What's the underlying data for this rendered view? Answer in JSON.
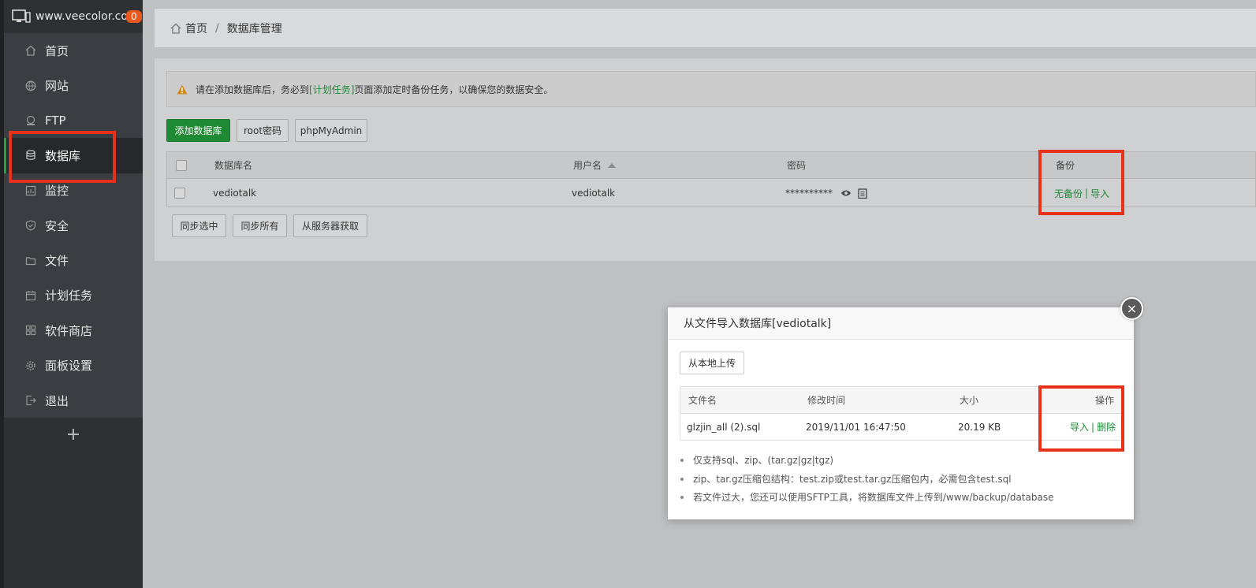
{
  "site": {
    "name": "www.veecolor.com",
    "badge": "0"
  },
  "nav": [
    {
      "label": "首页",
      "icon": "home-icon"
    },
    {
      "label": "网站",
      "icon": "globe-icon"
    },
    {
      "label": "FTP",
      "icon": "ftp-icon"
    },
    {
      "label": "数据库",
      "icon": "database-icon",
      "active": true
    },
    {
      "label": "监控",
      "icon": "monitor-chart-icon"
    },
    {
      "label": "安全",
      "icon": "shield-icon"
    },
    {
      "label": "文件",
      "icon": "folder-icon"
    },
    {
      "label": "计划任务",
      "icon": "calendar-icon"
    },
    {
      "label": "软件商店",
      "icon": "apps-grid-icon"
    },
    {
      "label": "面板设置",
      "icon": "gear-icon"
    },
    {
      "label": "退出",
      "icon": "logout-icon"
    }
  ],
  "nav_add": "+",
  "breadcrumb": {
    "home": "首页",
    "sep": "/",
    "current": "数据库管理"
  },
  "alert": {
    "before": "请在添加数据库后，务必到",
    "link": "[计划任务]",
    "after": "页面添加定时备份任务，以确保您的数据安全。"
  },
  "toolbar": {
    "add_db": "添加数据库",
    "root_pwd": "root密码",
    "phpmyadmin": "phpMyAdmin"
  },
  "table": {
    "headers": {
      "name": "数据库名",
      "user": "用户名",
      "password": "密码",
      "backup": "备份"
    },
    "rows": [
      {
        "name": "vediotalk",
        "user": "vediotalk",
        "password": "**********",
        "no_backup": "无备份",
        "sep": "|",
        "import": "导入"
      }
    ]
  },
  "bottom_buttons": {
    "sync_selected": "同步选中",
    "sync_all": "同步所有",
    "fetch_server": "从服务器获取"
  },
  "modal": {
    "title": "从文件导入数据库[vediotalk]",
    "close": "×",
    "upload": "从本地上传",
    "headers": {
      "file": "文件名",
      "mtime": "修改时间",
      "size": "大小",
      "ops": "操作"
    },
    "rows": [
      {
        "file": "glzjin_all (2).sql",
        "mtime": "2019/11/01 16:47:50",
        "size": "20.19 KB",
        "import": "导入",
        "sep": "|",
        "delete": "删除"
      }
    ],
    "notes": [
      "仅支持sql、zip、(tar.gz|gz|tgz)",
      "zip、tar.gz压缩包结构：test.zip或test.tar.gz压缩包内，必需包含test.sql",
      "若文件过大，您还可以使用SFTP工具，将数据库文件上传到/www/backup/database"
    ]
  },
  "colors": {
    "accent_green": "#20a53a",
    "highlight_red": "#e8311a",
    "badge_orange": "#e8581f"
  }
}
